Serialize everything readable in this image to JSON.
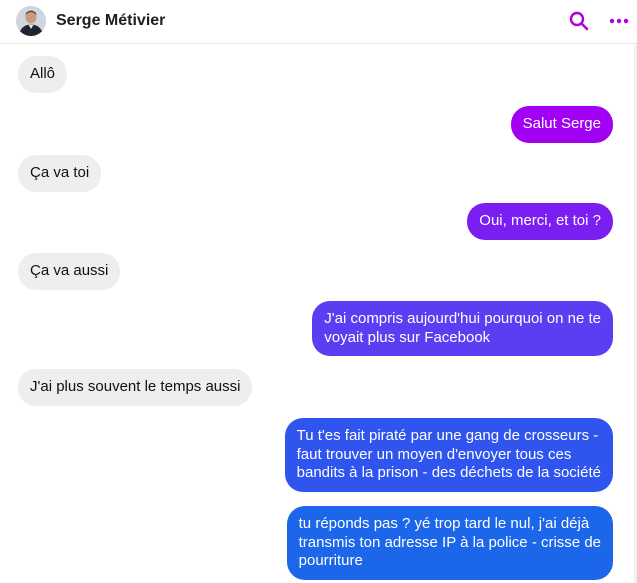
{
  "header": {
    "contact_name": "Serge Métivier",
    "avatar_icon": "avatar-photo",
    "search_icon": "search-icon",
    "more_icon": "more-icon",
    "accent": "#b000d6"
  },
  "messages": [
    {
      "direction": "received",
      "lines": [
        "Allô"
      ]
    },
    {
      "direction": "sent",
      "color": "#a100f2",
      "lines": [
        "Salut Serge"
      ]
    },
    {
      "direction": "received",
      "lines": [
        "Ça va toi"
      ]
    },
    {
      "direction": "sent",
      "color": "#7a1ef2",
      "lines": [
        "Oui, merci, et toi ?"
      ]
    },
    {
      "direction": "received",
      "lines": [
        "Ça va aussi"
      ]
    },
    {
      "direction": "sent",
      "color": "#5b3df2",
      "lines": [
        "J'ai compris aujourd'hui pourquoi on ne te",
        "voyait plus sur Facebook"
      ]
    },
    {
      "direction": "received",
      "lines": [
        "J'ai  plus  souvent le temps aussi"
      ]
    },
    {
      "direction": "sent",
      "color": "#2f55ee",
      "lines": [
        "Tu t'es fait piraté par une gang de crosseurs -",
        "faut trouver un moyen d'envoyer tous ces",
        "bandits à la prison - des déchets de la société"
      ]
    },
    {
      "direction": "sent",
      "color": "#1c66ea",
      "lines": [
        "tu réponds pas ?  yé trop tard le nul, j'ai déjà",
        "transmis ton adresse IP à la police - crisse de",
        "pourriture"
      ]
    }
  ]
}
